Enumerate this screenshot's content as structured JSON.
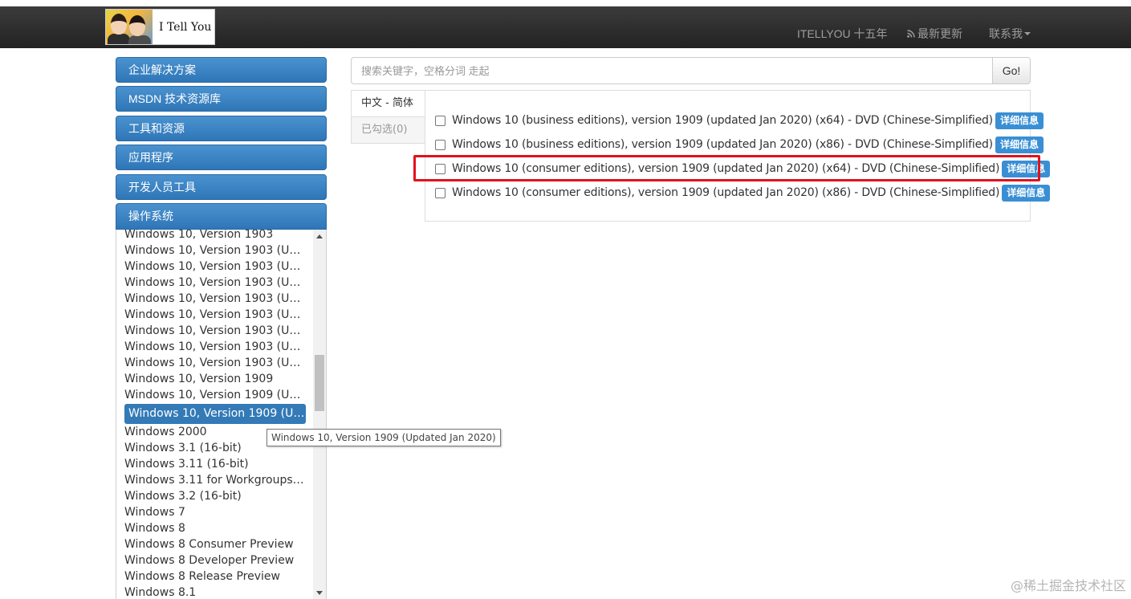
{
  "header": {
    "brand_text": "I Tell You",
    "nav": {
      "anniversary": "ITELLYOU 十五年",
      "latest_updates": "最新更新",
      "contact": "联系我"
    }
  },
  "sidebar": {
    "categories": [
      {
        "label": "企业解决方案"
      },
      {
        "label": "MSDN 技术资源库"
      },
      {
        "label": "工具和资源"
      },
      {
        "label": "应用程序"
      },
      {
        "label": "开发人员工具"
      },
      {
        "label": "操作系统"
      }
    ],
    "os_items": [
      "Windows 10, Version 1903",
      "Windows 10, Version 1903 (Upd...",
      "Windows 10, Version 1903 (Upd...",
      "Windows 10, Version 1903 (Upd...",
      "Windows 10, Version 1903 (Upd...",
      "Windows 10, Version 1903 (Upd...",
      "Windows 10, Version 1903 (Upd...",
      "Windows 10, Version 1903 (Upd...",
      "Windows 10, Version 1903 (Upd...",
      "Windows 10, Version 1909",
      "Windows 10, Version 1909 (Upd...",
      "Windows 10, Version 1909 (Upd...",
      "Windows 2000",
      "Windows 3.1 (16-bit)",
      "Windows 3.11 (16-bit)",
      "Windows 3.11 for Workgroups (1...",
      "Windows 3.2 (16-bit)",
      "Windows 7",
      "Windows 8",
      "Windows 8 Consumer Preview",
      "Windows 8 Developer Preview",
      "Windows 8 Release Preview",
      "Windows 8.1"
    ],
    "active_index": 11,
    "tooltip": "Windows 10, Version 1909 (Updated Jan 2020)"
  },
  "search": {
    "placeholder": "搜索关键字，空格分词 走起",
    "button_label": "Go!"
  },
  "tabs": {
    "language": "中文 - 简体",
    "selected": "已勾选(0)"
  },
  "results": [
    {
      "text": "Windows 10 (business editions), version 1909 (updated Jan 2020) (x64) - DVD (Chinese-Simplified)",
      "button": "详细信息",
      "highlighted": false
    },
    {
      "text": "Windows 10 (business editions), version 1909 (updated Jan 2020) (x86) - DVD (Chinese-Simplified)",
      "button": "详细信息",
      "highlighted": false
    },
    {
      "text": "Windows 10 (consumer editions), version 1909 (updated Jan 2020) (x64) - DVD (Chinese-Simplified)",
      "button": "详细信息",
      "highlighted": true
    },
    {
      "text": "Windows 10 (consumer editions), version 1909 (updated Jan 2020) (x86) - DVD (Chinese-Simplified)",
      "button": "详细信息",
      "highlighted": false
    }
  ],
  "watermark": "@稀土掘金技术社区",
  "colors": {
    "accent_blue": "#337ab7",
    "highlight_red": "#e0131c",
    "navbar_dark": "#222222"
  }
}
